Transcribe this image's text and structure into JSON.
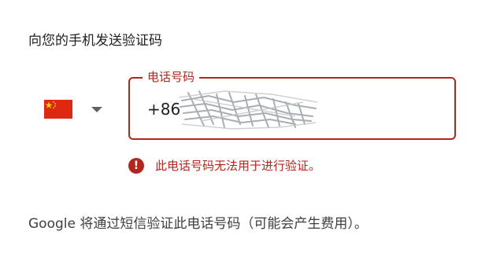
{
  "header": {
    "title": "向您的手机发送验证码"
  },
  "country": {
    "flag_icon": "china-flag-icon",
    "dropdown_icon": "caret-down-icon"
  },
  "phone": {
    "label": "电话号码",
    "value": "+86"
  },
  "error": {
    "icon": "error-exclamation-icon",
    "message": "此电话号码无法用于进行验证。"
  },
  "footnote": {
    "text": "Google 将通过短信验证此电话号码（可能会产生费用）。"
  },
  "colors": {
    "error": "#b3261e",
    "text": "#202124",
    "muted": "#3c4043",
    "flag_red": "#de2910",
    "flag_yellow": "#ffde00"
  }
}
